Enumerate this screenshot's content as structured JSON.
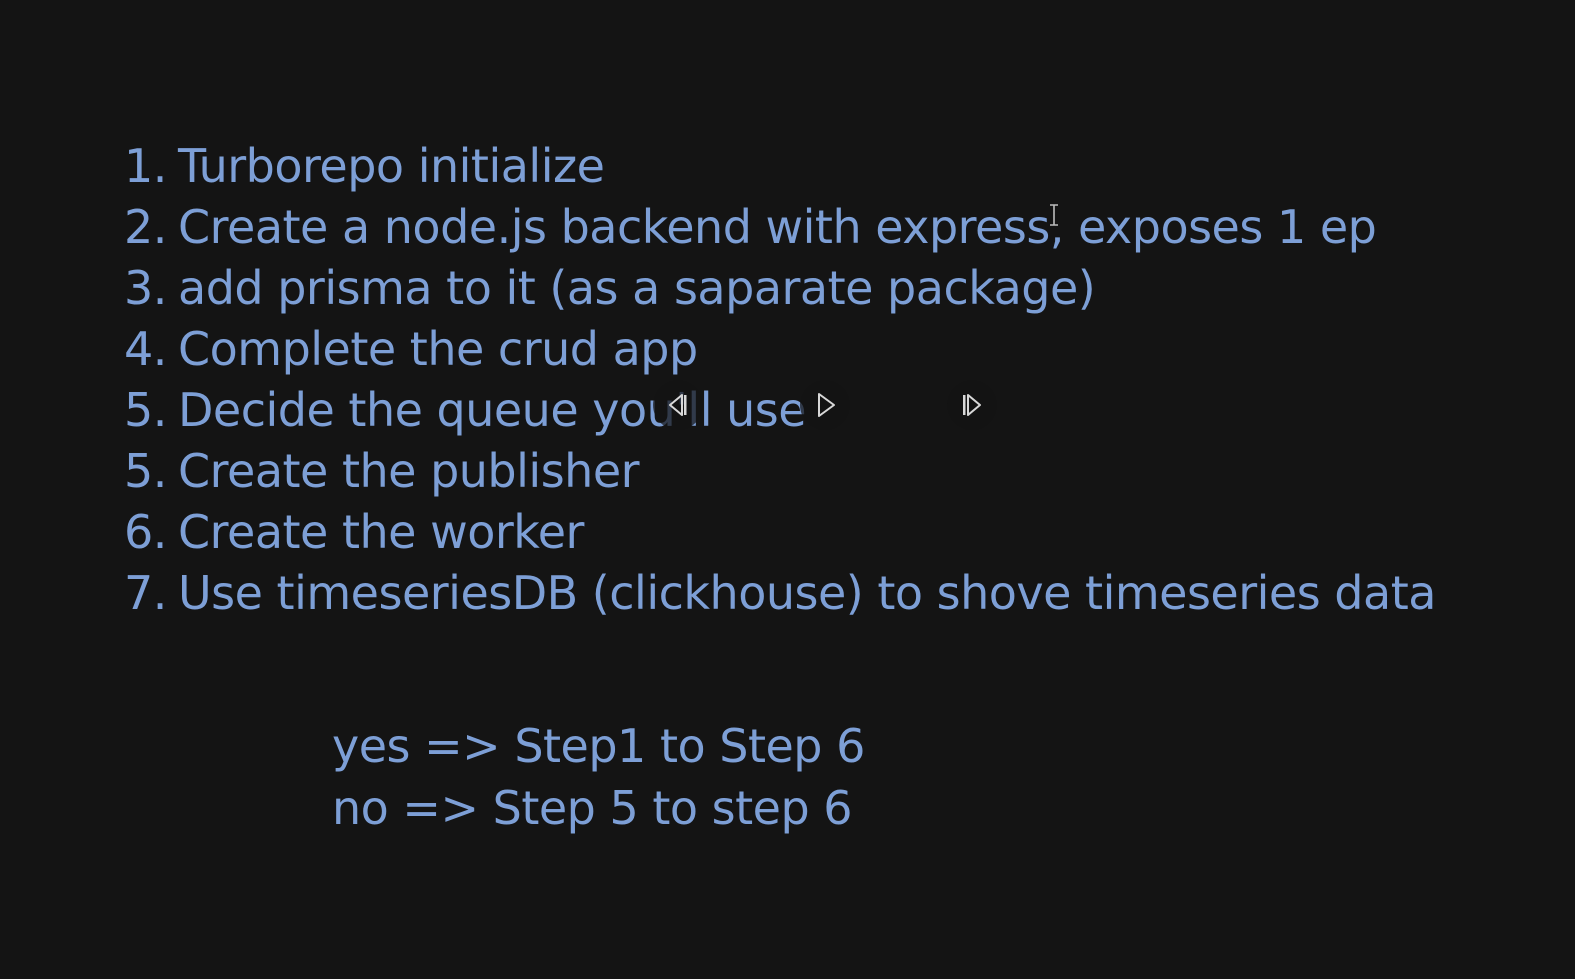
{
  "slide": {
    "steps": [
      {
        "num": "1.",
        "text": "Turborepo initialize"
      },
      {
        "num": "2.",
        "text": "Create a node.js backend with express, exposes 1 ep"
      },
      {
        "num": "3.",
        "text": "add prisma to it (as a saparate package)"
      },
      {
        "num": "4.",
        "text": "Complete the crud app"
      },
      {
        "num": "5.",
        "text": "Decide the queue you'll use"
      },
      {
        "num": "5.",
        "text": "Create the publisher"
      },
      {
        "num": "6.",
        "text": "Create the worker"
      },
      {
        "num": "7.",
        "text": "Use timeseriesDB (clickhouse) to shove timeseries data"
      }
    ],
    "answers": [
      {
        "text": "yes => Step1 to Step 6"
      },
      {
        "text": "no => Step 5 to step 6"
      }
    ]
  },
  "controls": {
    "prev_icon": "skip-back-icon",
    "play_icon": "play-icon",
    "next_icon": "skip-forward-icon",
    "icon_color": "#d8d8d8"
  },
  "colors": {
    "background": "#141414",
    "text": "#7d9fd6"
  }
}
